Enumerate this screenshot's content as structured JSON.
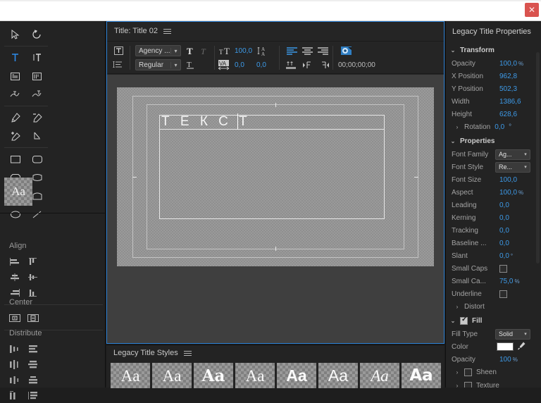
{
  "window": {
    "close_label": "✕"
  },
  "tools": {
    "items": [
      {
        "name": "selection-tool",
        "icon": "arrow"
      },
      {
        "name": "rotation-tool",
        "icon": "rotate"
      },
      {
        "name": "type-tool",
        "icon": "type-horizontal",
        "active": true
      },
      {
        "name": "vertical-type-tool",
        "icon": "type-vertical"
      },
      {
        "name": "area-type-tool",
        "icon": "area-type"
      },
      {
        "name": "vertical-area-type-tool",
        "icon": "area-type-vertical"
      },
      {
        "name": "path-type-tool",
        "icon": "path-type"
      },
      {
        "name": "vertical-path-type-tool",
        "icon": "path-type-vertical"
      },
      {
        "name": "pen-tool",
        "icon": "pen"
      },
      {
        "name": "delete-anchor-point-tool",
        "icon": "pen-minus"
      },
      {
        "name": "add-anchor-point-tool",
        "icon": "pen-plus"
      },
      {
        "name": "convert-anchor-point-tool",
        "icon": "convert-anchor"
      },
      {
        "name": "rectangle-tool",
        "icon": "rectangle"
      },
      {
        "name": "rounded-rectangle-tool",
        "icon": "rounded-rect"
      },
      {
        "name": "clipped-rectangle-tool",
        "icon": "clipped-rect"
      },
      {
        "name": "wedge-tool",
        "icon": "wedge"
      },
      {
        "name": "triangle-tool",
        "icon": "triangle"
      },
      {
        "name": "arc-tool",
        "icon": "arc"
      },
      {
        "name": "ellipse-tool",
        "icon": "ellipse"
      },
      {
        "name": "line-tool",
        "icon": "line"
      }
    ],
    "font_swatch_label": "Aa",
    "align_title": "Align",
    "center_title": "Center",
    "distribute_title": "Distribute"
  },
  "title_panel": {
    "title": "Title: Title 02",
    "font_family": "Agency ...",
    "font_style": "Regular",
    "font_size": "100,0",
    "kerning": "0,0",
    "leading": "0,0",
    "tracking": "0,0",
    "timecode": "00;00;00;00"
  },
  "canvas": {
    "text": "Т Е К С Т"
  },
  "styles_panel": {
    "title": "Legacy Title Styles",
    "chips": [
      {
        "label": "Aa",
        "family": "\"Liberation Serif\", serif",
        "weight": "normal",
        "style": "normal"
      },
      {
        "label": "Aa",
        "family": "\"Liberation Serif\", serif",
        "weight": "normal",
        "style": "normal"
      },
      {
        "label": "Aa",
        "family": "\"DejaVu Serif\", serif",
        "weight": "bold",
        "style": "normal"
      },
      {
        "label": "Aa",
        "family": "\"Liberation Serif\", serif",
        "weight": "normal",
        "style": "normal"
      },
      {
        "label": "Aa",
        "family": "\"Liberation Sans\", sans-serif",
        "weight": "bold",
        "style": "normal"
      },
      {
        "label": "Aa",
        "family": "\"Liberation Sans\", sans-serif",
        "weight": "normal",
        "style": "normal"
      },
      {
        "label": "Aa",
        "family": "\"Liberation Serif\", serif",
        "weight": "normal",
        "style": "italic"
      },
      {
        "label": "Aa",
        "family": "\"DejaVu Sans\", sans-serif",
        "weight": "bold",
        "style": "normal"
      }
    ]
  },
  "properties": {
    "title": "Legacy Title Properties",
    "transform": {
      "label": "Transform",
      "rows": [
        {
          "key": "Opacity",
          "value": "100,0",
          "unit": "%"
        },
        {
          "key": "X Position",
          "value": "962,8",
          "unit": ""
        },
        {
          "key": "Y Position",
          "value": "502,3",
          "unit": ""
        },
        {
          "key": "Width",
          "value": "1386,6",
          "unit": ""
        },
        {
          "key": "Height",
          "value": "628,6",
          "unit": ""
        }
      ],
      "rotation": {
        "key": "Rotation",
        "value": "0,0",
        "unit": "°"
      }
    },
    "properties_group": {
      "label": "Properties",
      "font_family_label": "Font Family",
      "font_family_value": "Ag...",
      "font_style_label": "Font Style",
      "font_style_value": "Re...",
      "rows": [
        {
          "key": "Font Size",
          "value": "100,0",
          "unit": ""
        },
        {
          "key": "Aspect",
          "value": "100,0",
          "unit": "%"
        },
        {
          "key": "Leading",
          "value": "0,0",
          "unit": ""
        },
        {
          "key": "Kerning",
          "value": "0,0",
          "unit": ""
        },
        {
          "key": "Tracking",
          "value": "0,0",
          "unit": ""
        },
        {
          "key": "Baseline ...",
          "value": "0,0",
          "unit": ""
        },
        {
          "key": "Slant",
          "value": "0,0",
          "unit": "°"
        }
      ],
      "small_caps_label": "Small Caps",
      "small_caps_checked": false,
      "small_caps_size_label": "Small Ca...",
      "small_caps_size_value": "75,0",
      "small_caps_size_unit": "%",
      "underline_label": "Underline",
      "underline_checked": false,
      "distort_label": "Distort"
    },
    "fill": {
      "label": "Fill",
      "checked": true,
      "fill_type_label": "Fill Type",
      "fill_type_value": "Solid",
      "color_label": "Color",
      "color_value": "#ffffff",
      "opacity_label": "Opacity",
      "opacity_value": "100",
      "opacity_unit": "%",
      "sheen_label": "Sheen",
      "texture_label": "Texture"
    }
  }
}
